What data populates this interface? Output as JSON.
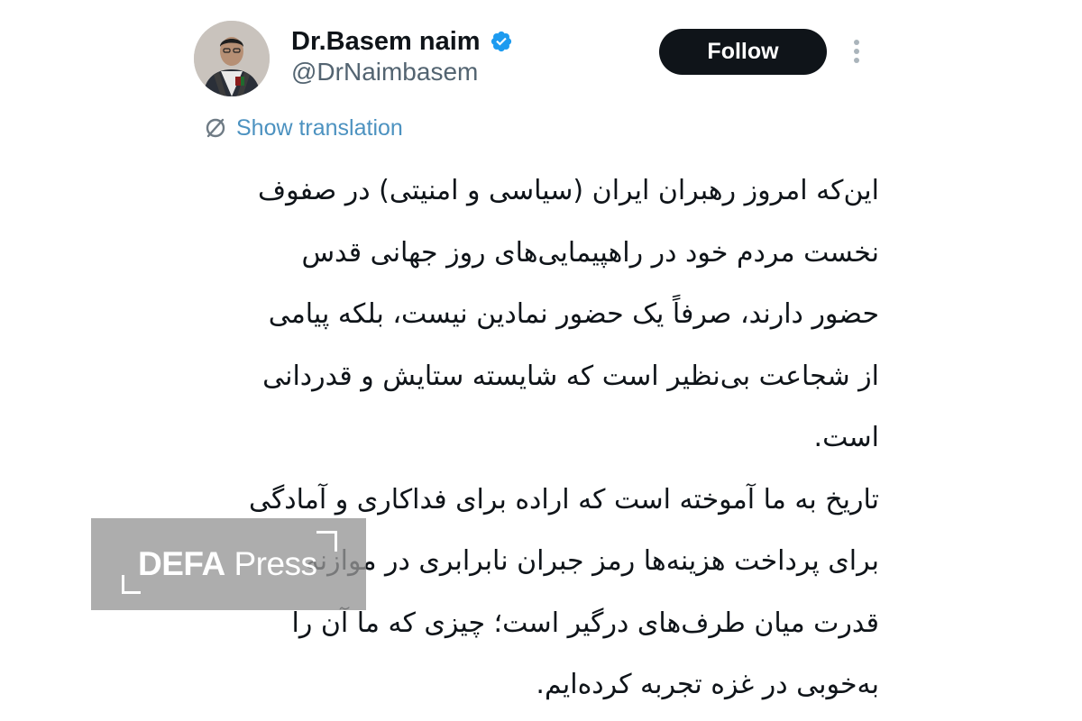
{
  "author": {
    "display_name": "Dr.Basem naim",
    "handle": "@DrNaimbasem",
    "verified_icon": "verified-badge-icon",
    "avatar_icon": "profile-photo"
  },
  "actions": {
    "follow_label": "Follow",
    "more_icon": "vertical-ellipsis-icon"
  },
  "translation": {
    "label": "Show translation",
    "icon": "translate-icon"
  },
  "tweet": {
    "lines": [
      "این‌که امروز رهبران ایران (سیاسی و امنیتی) در صفوف",
      "نخست مردم خود در راهپیمایی‌های روز جهانی قدس",
      "حضور دارند، صرفاً یک حضور نمادین نیست، بلکه پیامی",
      "از شجاعت بی‌نظیر است که شایسته ستایش و قدردانی",
      "است.",
      "تاریخ به ما آموخته است که اراده برای فداکاری و آمادگی",
      "برای پرداخت هزینه‌ها رمز جبران نابرابری در موازنه",
      "قدرت میان طرف‌های درگیر است؛ چیزی که ما آن را",
      "به‌خوبی در غزه تجربه کرده‌ایم."
    ]
  },
  "watermark": {
    "brand_bold": "DEFA",
    "brand_light": "Press"
  },
  "colors": {
    "text_primary": "#0f1419",
    "text_secondary": "#536471",
    "link": "#1d9bf0",
    "verified": "#1d9bf0",
    "follow_bg": "#0f1419"
  }
}
